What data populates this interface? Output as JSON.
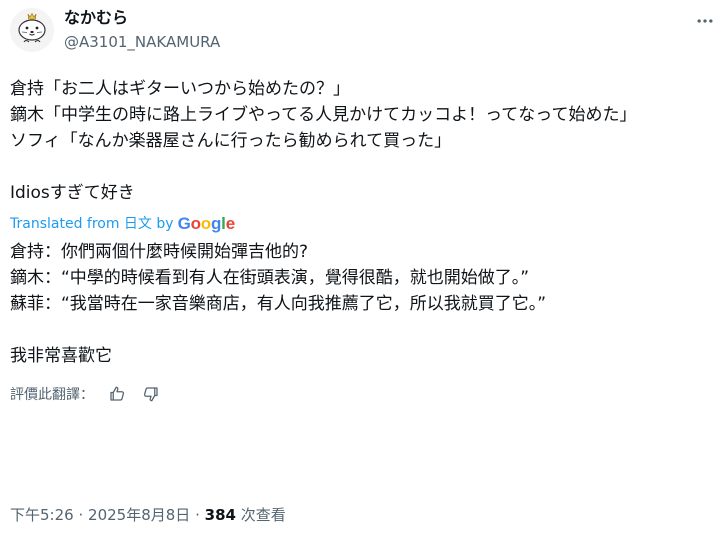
{
  "author": {
    "display_name": "なかむら",
    "handle": "@A3101_NAKAMURA",
    "avatar_icon": "seal-avatar"
  },
  "header": {
    "more_icon": "more-dots-icon"
  },
  "post": {
    "text": "倉持「お二人はギターいつから始めたの？」\n鏑木「中学生の時に路上ライブやってる人見かけてカッコよ！ってなって始めた」\nソフィ「なんか楽器屋さんに行ったら勧められて買った」\n\nIdiosすぎて好き",
    "translated_label": "Translated from 日文 by",
    "translated_by": "Google",
    "translated_text": "倉持：你們兩個什麼時候開始彈吉他的?\n鏑木：“中學的時候看到有人在街頭表演，覺得很酷，就也開始做了。”\n蘇菲：“我當時在一家音樂商店，有人向我推薦了它，所以我就買了它。”\n\n我非常喜歡它",
    "rate_label": "評價此翻譯：",
    "rate_icons": [
      "thumbs-up-icon",
      "thumbs-down-icon"
    ]
  },
  "meta": {
    "time": "下午5:26",
    "date": "2025年8月8日",
    "separator": "·",
    "views_count": "384",
    "views_label": "次查看"
  },
  "colors": {
    "link": "#1d9bf0",
    "muted": "#536471",
    "text": "#0f1419",
    "google_blue": "#4285F4",
    "google_red": "#EA4335",
    "google_yellow": "#FBBC05",
    "google_green": "#34A853"
  }
}
